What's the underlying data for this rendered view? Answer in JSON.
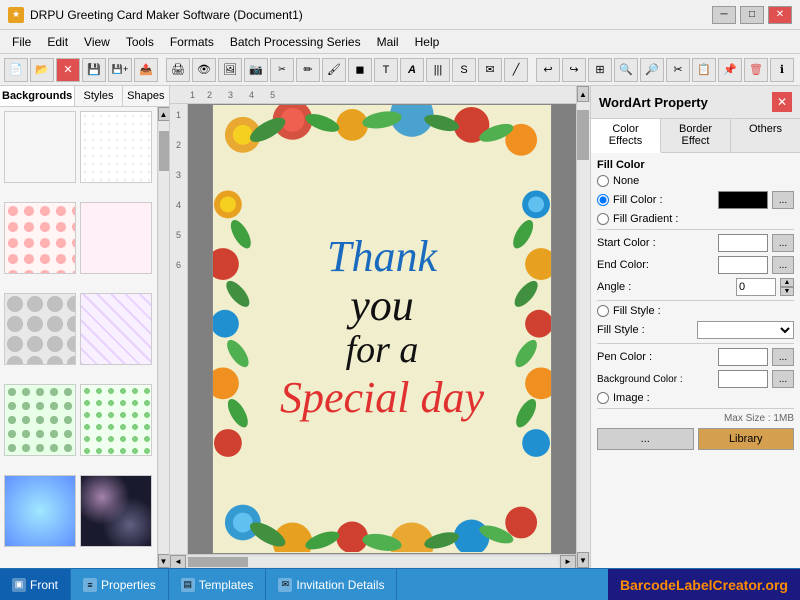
{
  "app": {
    "title": "DRPU Greeting Card Maker Software (Document1)",
    "icon": "★"
  },
  "titlebar": {
    "minimize": "─",
    "maximize": "□",
    "close": "✕"
  },
  "menu": {
    "items": [
      "File",
      "Edit",
      "View",
      "Tools",
      "Formats",
      "Batch Processing Series",
      "Mail",
      "Help"
    ]
  },
  "left_panel": {
    "tabs": [
      "Backgrounds",
      "Styles",
      "Shapes"
    ],
    "active_tab": "Backgrounds"
  },
  "canvas": {
    "card": {
      "line1": "Thank",
      "line2": "you",
      "line3": "for a",
      "line4": "Special day"
    }
  },
  "wordart_panel": {
    "title": "WordArt Property",
    "tabs": [
      "Color Effects",
      "Border Effect",
      "Others"
    ],
    "active_tab": "Color Effects",
    "fill_color_section": "Fill Color",
    "none_label": "None",
    "fill_color_label": "Fill Color :",
    "fill_gradient_label": "Fill Gradient :",
    "start_color_label": "Start Color :",
    "end_color_label": "End Color:",
    "angle_label": "Angle :",
    "angle_value": "0",
    "fill_style_section": "Fill Style :",
    "fill_style_label": "Fill Style :",
    "pen_color_label": "Pen Color :",
    "bg_color_label": "Background Color :",
    "image_label": "Image :",
    "max_size_label": "Max Size : 1MB",
    "browse_btn": "...",
    "library_btn": "Library",
    "dots_btn": "..."
  },
  "bottom": {
    "tabs": [
      {
        "icon": "▣",
        "label": "Front"
      },
      {
        "icon": "≡",
        "label": "Properties"
      },
      {
        "icon": "▤",
        "label": "Templates"
      },
      {
        "icon": "✉",
        "label": "Invitation Details"
      }
    ],
    "active_tab": "Front",
    "brand_text": "BarcodeLabelCreator.org"
  }
}
